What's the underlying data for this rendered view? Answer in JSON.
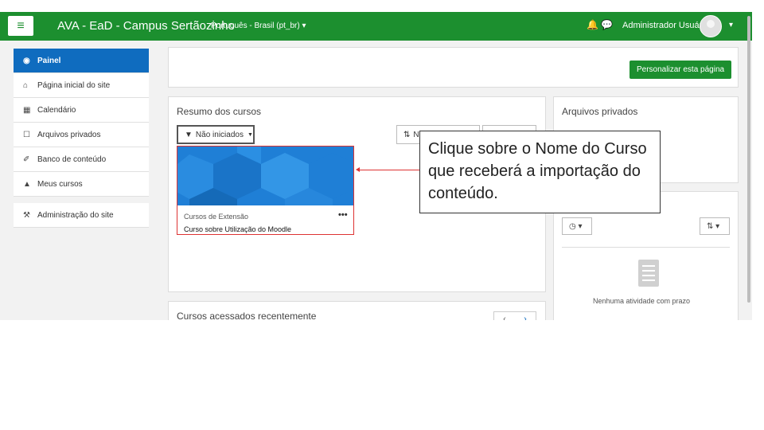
{
  "navbar": {
    "menu_icon": "hamburger-icon",
    "brand": "AVA - EaD - Campus Sertãozinho",
    "language": "Português - Brasil (pt_br) ▾",
    "notifications_icon": "bell-icon",
    "messages_icon": "chat-icon",
    "user_name": "Administrador Usuário",
    "user_menu_caret": "▾",
    "color": "#1c8f2f"
  },
  "sidebar": {
    "items": [
      {
        "label": "Painel",
        "icon": "dashboard-icon",
        "active": true
      },
      {
        "label": "Página inicial do site",
        "icon": "home-icon"
      },
      {
        "label": "Calendário",
        "icon": "calendar-icon"
      },
      {
        "label": "Arquivos privados",
        "icon": "file-icon"
      },
      {
        "label": "Banco de conteúdo",
        "icon": "brush-icon"
      },
      {
        "label": "Meus cursos",
        "icon": "graduation-cap-icon"
      }
    ],
    "admin": {
      "label": "Administração do site",
      "icon": "wrench-icon"
    }
  },
  "page": {
    "customize_button": "Personalizar esta página"
  },
  "course_overview": {
    "title": "Resumo dos cursos",
    "filter_label": "Não iniciados",
    "sort_label": "N",
    "course": {
      "category": "Cursos de Extensão",
      "name": "Curso sobre Utilização do Moodle",
      "menu": "•••"
    }
  },
  "callout": {
    "text": "Clique sobre o Nome do Curso que receberá a importação do conteúdo."
  },
  "private_files": {
    "title": "Arquivos privados"
  },
  "timeline": {
    "filter_icon": "clock-icon",
    "sort_icon": "sort-icon",
    "empty_text": "Nenhuma atividade com prazo"
  },
  "recent_courses": {
    "title": "Cursos acessados recentemente",
    "prev": "‹",
    "next": "›"
  }
}
